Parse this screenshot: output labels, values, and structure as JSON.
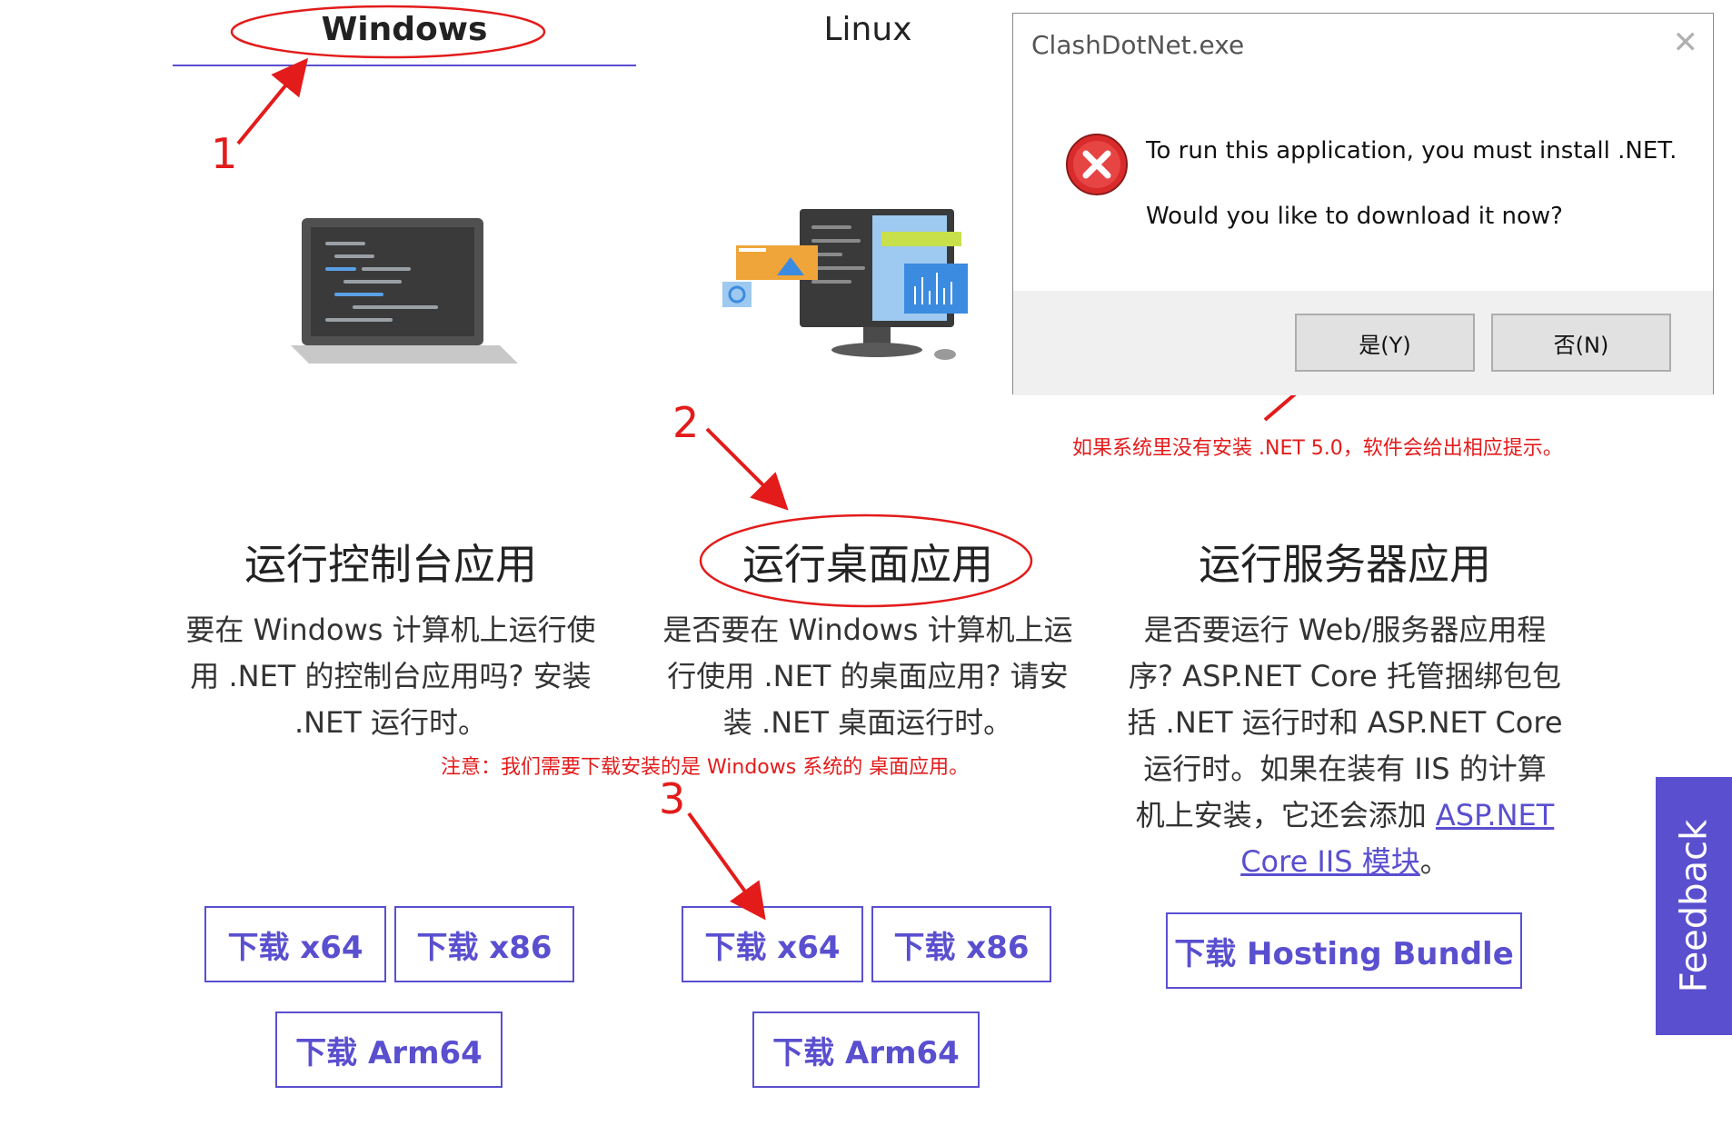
{
  "tabs": {
    "windows": "Windows",
    "linux": "Linux"
  },
  "columns": [
    {
      "title": "运行控制台应用",
      "body": [
        "要在 Windows 计算机上运行使",
        "用 .NET 的控制台应用吗? 安装",
        ".NET 运行时。"
      ],
      "buttons": [
        "下载 x64",
        "下载 x86",
        "下载 Arm64"
      ]
    },
    {
      "title": "运行桌面应用",
      "body": [
        "是否要在 Windows 计算机上运",
        "行使用 .NET 的桌面应用? 请安",
        "装 .NET 桌面运行时。"
      ],
      "buttons": [
        "下载 x64",
        "下载 x86",
        "下载 Arm64"
      ]
    },
    {
      "title": "运行服务器应用",
      "body": [
        "是否要运行 Web/服务器应用程",
        "序? ASP.NET Core 托管捆绑包包",
        "括 .NET 运行时和 ASP.NET Core",
        "运行时。如果在装有 IIS 的计算",
        "机上安装，它还会添加 "
      ],
      "link1": "ASP.NET",
      "link2": "Core IIS 模块",
      "body_end": "。",
      "buttons": [
        "下载 Hosting Bundle"
      ]
    }
  ],
  "annotations": {
    "step1": "1",
    "step2": "2",
    "step3": "3",
    "note_desktop": "注意：我们需要下载安装的是 Windows 系统的 桌面应用。",
    "note_dialog": "如果系统里没有安装 .NET 5.0，软件会给出相应提示。"
  },
  "dialog": {
    "title": "ClashDotNet.exe",
    "close_glyph": "✕",
    "message1": "To run this application, you must install .NET.",
    "message2": "Would you like to download it now?",
    "yes_label": "是(Y)",
    "no_label": "否(N)"
  },
  "feedback_label": "Feedback",
  "colors": {
    "accent": "#5a4fcf",
    "annotation_red": "#e31b1b"
  }
}
